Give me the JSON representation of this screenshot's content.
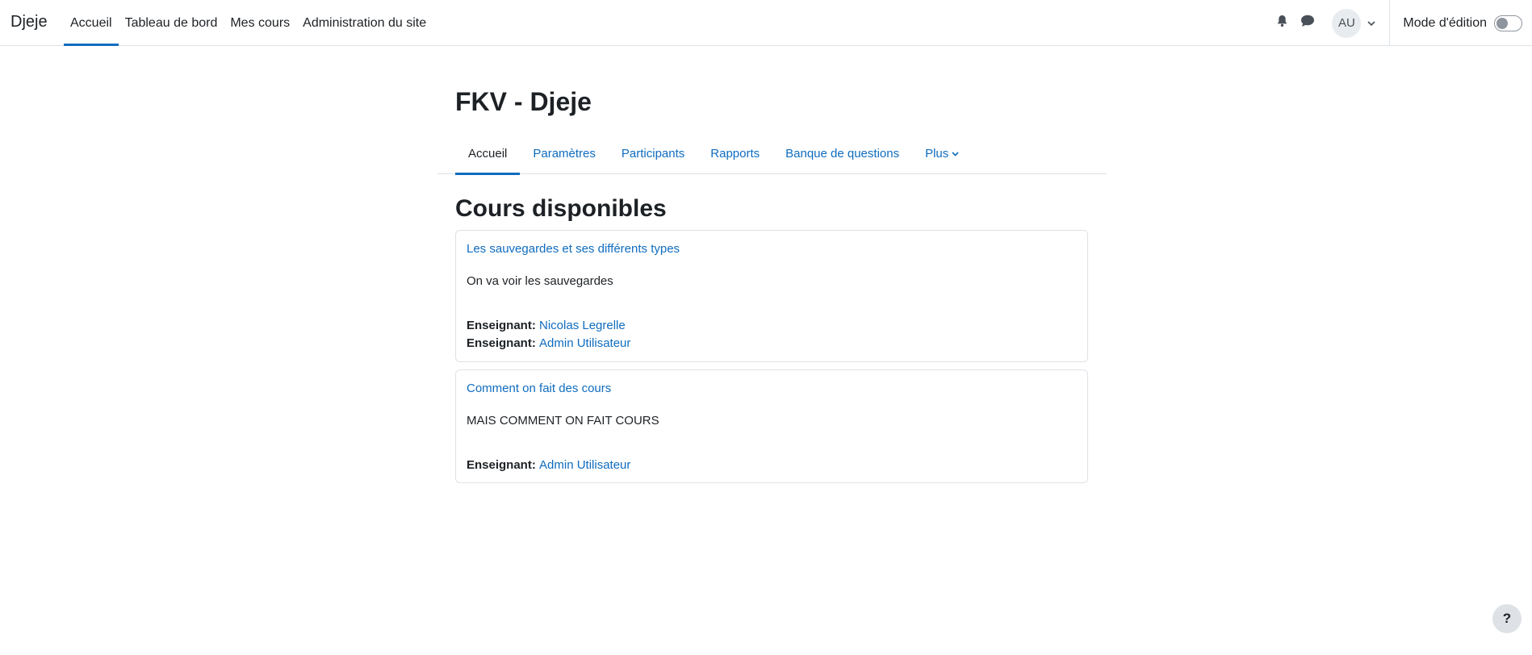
{
  "navbar": {
    "brand": "Djeje",
    "items": [
      {
        "label": "Accueil",
        "active": true
      },
      {
        "label": "Tableau de bord",
        "active": false
      },
      {
        "label": "Mes cours",
        "active": false
      },
      {
        "label": "Administration du site",
        "active": false
      }
    ],
    "icons": {
      "notifications": "bell-icon",
      "messages": "chat-bubble-icon"
    },
    "user_initials": "AU",
    "edit_mode_label": "Mode d'édition",
    "edit_mode_on": false
  },
  "page": {
    "title": "FKV - Djeje"
  },
  "secondary_nav": {
    "tabs": [
      {
        "label": "Accueil",
        "active": true
      },
      {
        "label": "Paramètres",
        "active": false
      },
      {
        "label": "Participants",
        "active": false
      },
      {
        "label": "Rapports",
        "active": false
      },
      {
        "label": "Banque de questions",
        "active": false
      },
      {
        "label": "Plus",
        "active": false,
        "dropdown": true
      }
    ]
  },
  "courses": {
    "heading": "Cours disponibles",
    "items": [
      {
        "title": "Les sauvegardes et ses différents types",
        "summary": "On va voir les sauvegardes",
        "teachers": [
          {
            "role": "Enseignant:",
            "name": "Nicolas Legrelle"
          },
          {
            "role": "Enseignant:",
            "name": "Admin Utilisateur"
          }
        ]
      },
      {
        "title": "Comment on fait des cours",
        "summary": "MAIS COMMENT ON FAIT COURS",
        "teachers": [
          {
            "role": "Enseignant:",
            "name": "Admin Utilisateur"
          }
        ]
      }
    ]
  },
  "help": {
    "label": "?"
  },
  "colors": {
    "link": "#0f6cbf",
    "text": "#1d2125",
    "border": "#dee2e6",
    "active_indicator": "#0f6cbf"
  }
}
